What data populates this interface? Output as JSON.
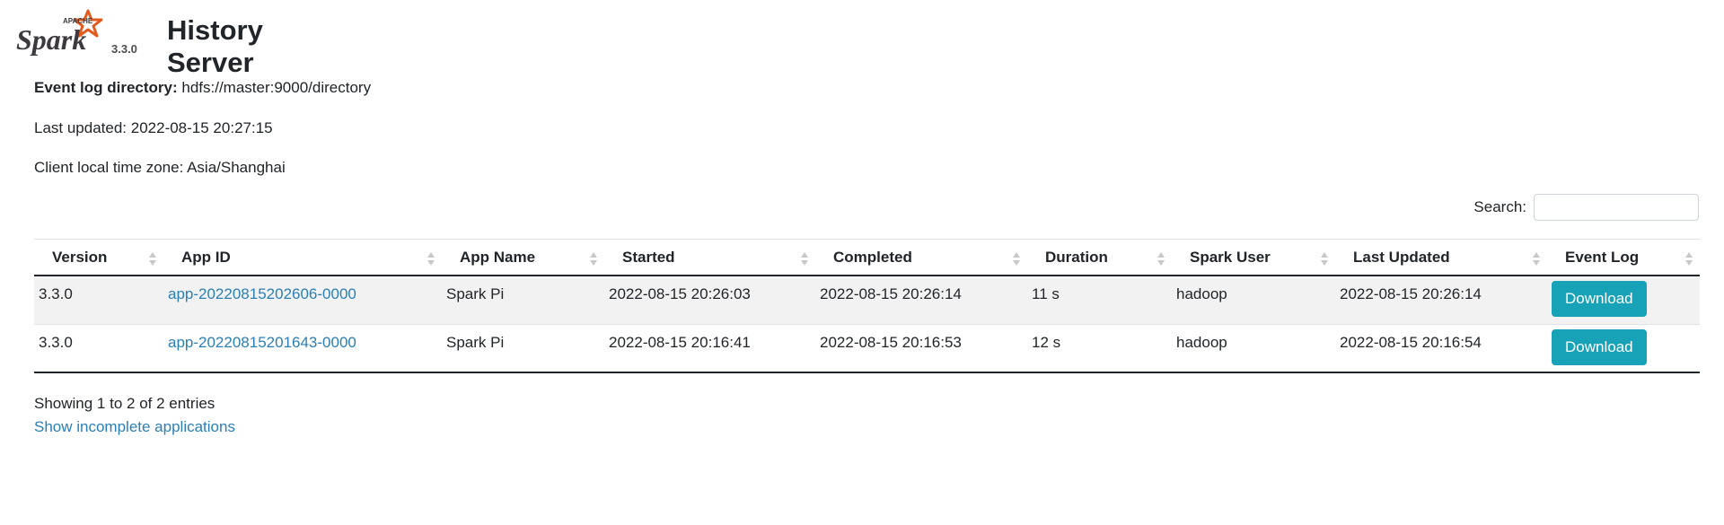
{
  "header": {
    "logo_text": "Spark",
    "logo_sub": "APACHE",
    "version": "3.3.0",
    "title": "History Server"
  },
  "info": {
    "event_log_label": "Event log directory:",
    "event_log_value": "hdfs://master:9000/directory",
    "last_updated": "Last updated: 2022-08-15 20:27:15",
    "timezone": "Client local time zone: Asia/Shanghai"
  },
  "search": {
    "label": "Search:",
    "value": ""
  },
  "table": {
    "columns": [
      "Version",
      "App ID",
      "App Name",
      "Started",
      "Completed",
      "Duration",
      "Spark User",
      "Last Updated",
      "Event Log"
    ],
    "rows": [
      {
        "version": "3.3.0",
        "app_id": "app-20220815202606-0000",
        "app_name": "Spark Pi",
        "started": "2022-08-15 20:26:03",
        "completed": "2022-08-15 20:26:14",
        "duration": "11 s",
        "user": "hadoop",
        "last_updated": "2022-08-15 20:26:14",
        "event_log": "Download"
      },
      {
        "version": "3.3.0",
        "app_id": "app-20220815201643-0000",
        "app_name": "Spark Pi",
        "started": "2022-08-15 20:16:41",
        "completed": "2022-08-15 20:16:53",
        "duration": "12 s",
        "user": "hadoop",
        "last_updated": "2022-08-15 20:16:54",
        "event_log": "Download"
      }
    ]
  },
  "footer": {
    "showing": "Showing 1 to 2 of 2 entries",
    "incomplete_link": "Show incomplete applications"
  },
  "colors": {
    "link": "#2a7fb5",
    "button": "#17a2b8",
    "logo_star": "#e25a1c",
    "logo_text": "#3c3a3e"
  }
}
